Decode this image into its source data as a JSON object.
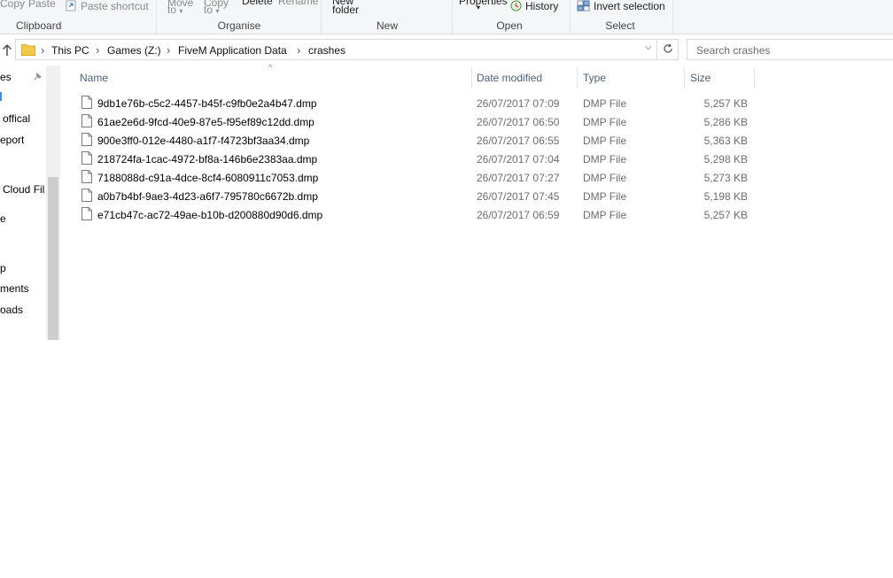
{
  "ribbon": {
    "clipboard": {
      "label": "Clipboard",
      "copy": "Copy",
      "paste": "Paste",
      "paste_shortcut": "Paste shortcut"
    },
    "organise": {
      "label": "Organise",
      "move_to": "Move",
      "move_to_sub": "to",
      "copy_to": "Copy",
      "copy_to_sub": "to",
      "delete": "Delete",
      "rename": "Rename"
    },
    "new": {
      "label": "New",
      "new_folder_top": "New",
      "new_folder": "folder"
    },
    "open": {
      "label": "Open",
      "properties": "Properties",
      "history": "History"
    },
    "select": {
      "label": "Select",
      "invert_selection": "Invert selection"
    }
  },
  "address": {
    "crumbs": [
      "This PC",
      "Games (Z:)",
      "FiveM Application Data",
      "crashes"
    ]
  },
  "search": {
    "placeholder": "Search crashes"
  },
  "nav": {
    "items": [
      "es",
      "",
      "offical",
      "eport",
      "Cloud Fil",
      "e",
      "p",
      "ments",
      "oads"
    ]
  },
  "columns": {
    "name": "Name",
    "date": "Date modified",
    "type": "Type",
    "size": "Size"
  },
  "files": [
    {
      "name": "9db1e76b-c5c2-4457-b45f-c9fb0e2a4b47.dmp",
      "date": "26/07/2017 07:09",
      "type": "DMP File",
      "size": "5,257 KB"
    },
    {
      "name": "61ae2e6d-9fcd-40e9-87e5-f95ef89c12dd.dmp",
      "date": "26/07/2017 06:50",
      "type": "DMP File",
      "size": "5,286 KB"
    },
    {
      "name": "900e3ff0-012e-4480-a1f7-f4723bf3aa34.dmp",
      "date": "26/07/2017 06:55",
      "type": "DMP File",
      "size": "5,363 KB"
    },
    {
      "name": "218724fa-1cac-4972-bf8a-146b6e2383aa.dmp",
      "date": "26/07/2017 07:04",
      "type": "DMP File",
      "size": "5,298 KB"
    },
    {
      "name": "7188088d-c91a-4dce-8cf4-6080911c7053.dmp",
      "date": "26/07/2017 07:27",
      "type": "DMP File",
      "size": "5,273 KB"
    },
    {
      "name": "a0b7b4bf-9ae3-4d23-a6f7-795780c6672b.dmp",
      "date": "26/07/2017 07:45",
      "type": "DMP File",
      "size": "5,198 KB"
    },
    {
      "name": "e71cb47c-ac72-49ae-b10b-d200880d90d6.dmp",
      "date": "26/07/2017 06:59",
      "type": "DMP File",
      "size": "5,257 KB"
    }
  ],
  "colors": {
    "header_text": "#4c607a",
    "meta_text": "#6d6d6d",
    "folder": "#f4c84a"
  }
}
